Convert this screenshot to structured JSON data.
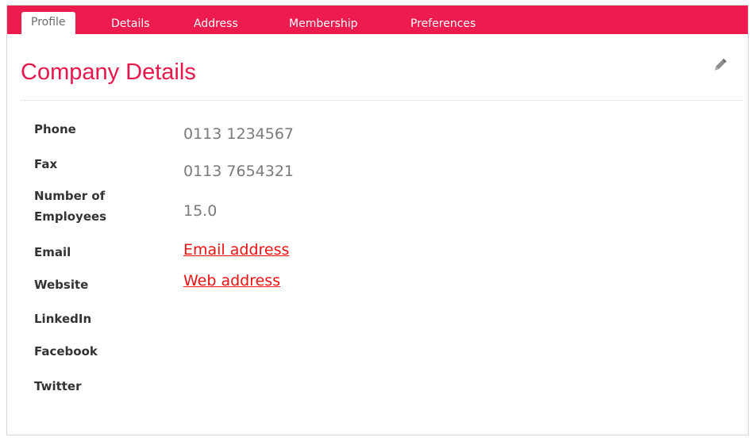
{
  "tabs": [
    {
      "label": "Profile",
      "active": true
    },
    {
      "label": "Details",
      "active": false
    },
    {
      "label": "Address",
      "active": false
    },
    {
      "label": "Membership",
      "active": false
    },
    {
      "label": "Preferences",
      "active": false
    }
  ],
  "panel": {
    "title": "Company Details",
    "edit_icon": "pencil-icon"
  },
  "fields": {
    "phone": {
      "label": "Phone",
      "value": "0113 1234567"
    },
    "fax": {
      "label": "Fax",
      "value": "0113 7654321"
    },
    "employees": {
      "label_line1": "Number of",
      "label_line2": "Employees",
      "value": "15.0"
    },
    "email": {
      "label": "Email",
      "value": "Email address"
    },
    "website": {
      "label": "Website",
      "value": "Web address"
    },
    "linkedin": {
      "label": "LinkedIn",
      "value": ""
    },
    "facebook": {
      "label": "Facebook",
      "value": ""
    },
    "twitter": {
      "label": "Twitter",
      "value": ""
    }
  },
  "colors": {
    "accent": "#ee1b4f",
    "title": "#e8174b",
    "link": "#ee1111",
    "value_text": "#7a7a7a"
  }
}
